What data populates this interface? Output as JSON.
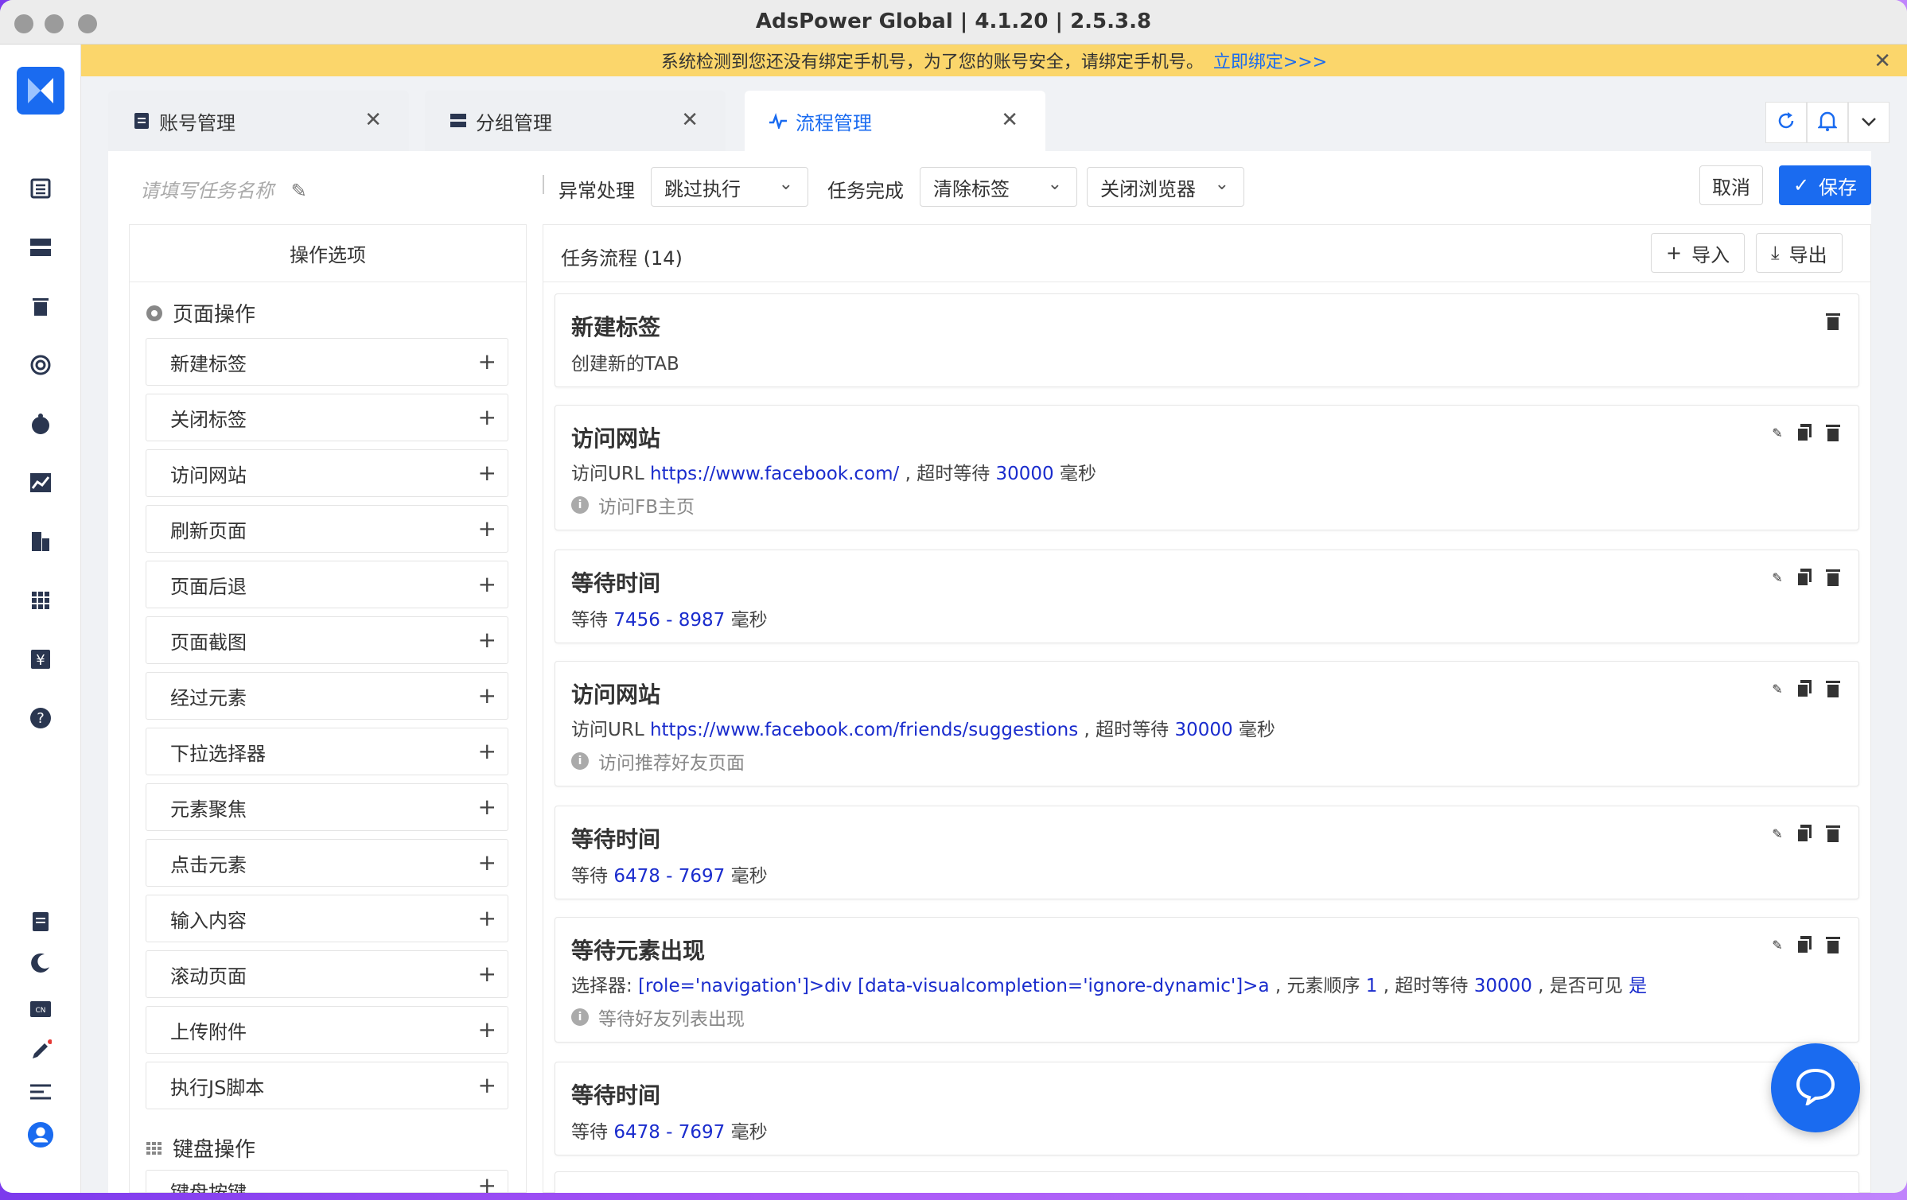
{
  "window": {
    "title": "AdsPower Global | 4.1.20 | 2.5.3.8"
  },
  "banner": {
    "text": "系统检测到您还没有绑定手机号，为了您的账号安全，请绑定手机号。",
    "link": "立即绑定>>>"
  },
  "tabs": [
    {
      "label": "账号管理",
      "icon": "list-icon"
    },
    {
      "label": "分组管理",
      "icon": "group-icon"
    },
    {
      "label": "流程管理",
      "icon": "pulse-icon"
    }
  ],
  "toolbar": {
    "task_name_placeholder": "请填写任务名称",
    "exception_label": "异常处理",
    "exception_value": "跳过执行",
    "complete_label": "任务完成",
    "complete_value1": "清除标签",
    "complete_value2": "关闭浏览器",
    "cancel": "取消",
    "save": "保存"
  },
  "options": {
    "header": "操作选项",
    "group_page": "页面操作",
    "items": [
      "新建标签",
      "关闭标签",
      "访问网站",
      "刷新页面",
      "页面后退",
      "页面截图",
      "经过元素",
      "下拉选择器",
      "元素聚焦",
      "点击元素",
      "输入内容",
      "滚动页面",
      "上传附件",
      "执行JS脚本"
    ],
    "group_keyboard": "键盘操作",
    "keyboard_items": [
      "键盘按键"
    ]
  },
  "flow": {
    "title": "任务流程 (14)",
    "import": "导入",
    "export": "导出",
    "cards": [
      {
        "title": "新建标签",
        "line": "创建新的TAB"
      },
      {
        "title": "访问网站",
        "prefix": "访问URL ",
        "url": "https://www.facebook.com/",
        "mid": " , 超时等待 ",
        "timeout": "30000",
        "unit": " 毫秒",
        "note": "访问FB主页"
      },
      {
        "title": "等待时间",
        "prefix": "等待 ",
        "range": "7456 - 8987",
        "unit": " 毫秒"
      },
      {
        "title": "访问网站",
        "prefix": "访问URL ",
        "url": "https://www.facebook.com/friends/suggestions",
        "mid": " , 超时等待 ",
        "timeout": "30000",
        "unit": " 毫秒",
        "note": "访问推荐好友页面"
      },
      {
        "title": "等待时间",
        "prefix": "等待 ",
        "range": "6478 - 7697",
        "unit": " 毫秒"
      },
      {
        "title": "等待元素出现",
        "prefix": "选择器: ",
        "selector": "[role='navigation']>div [data-visualcompletion='ignore-dynamic']>a",
        "order_label": " , 元素顺序 ",
        "order": "1",
        "mid": " , 超时等待 ",
        "timeout": "30000",
        "visible_label": " , 是否可见 ",
        "visible": "是",
        "note": "等待好友列表出现"
      },
      {
        "title": "等待时间",
        "prefix": "等待 ",
        "range": "6478 - 7697",
        "unit": " 毫秒"
      }
    ]
  },
  "colors": {
    "accent": "#1a6bf0",
    "banner": "#fbd66b",
    "value_blue": "#1a2ccd"
  }
}
